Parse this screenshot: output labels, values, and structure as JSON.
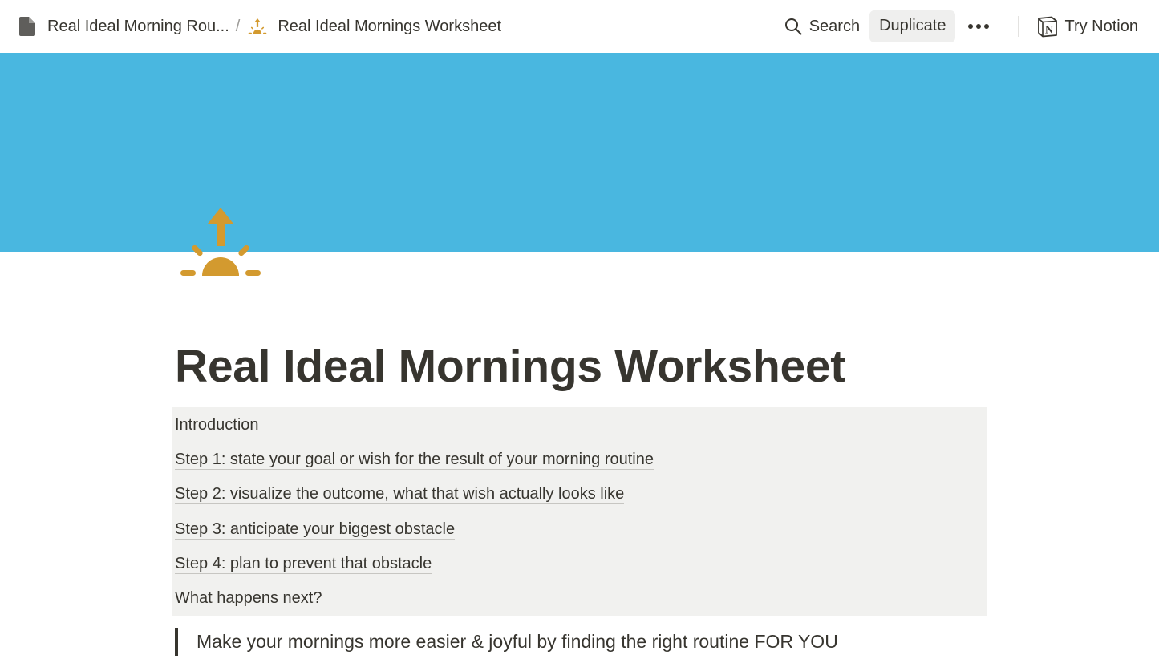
{
  "topbar": {
    "breadcrumb": [
      {
        "label": "Real Ideal Morning Rou...",
        "icon": "document-icon"
      },
      {
        "label": "Real Ideal Mornings Worksheet",
        "icon": "sunrise-icon"
      }
    ],
    "separator": "/",
    "search_label": "Search",
    "duplicate_label": "Duplicate",
    "try_label": "Try Notion"
  },
  "page": {
    "cover_color": "#49b7e0",
    "icon": "sunrise-icon",
    "icon_color": "#d39a2f",
    "title": "Real Ideal Mornings Worksheet",
    "toc": [
      "Introduction",
      "Step 1: state your goal or wish for the result of your morning routine",
      "Step 2: visualize the outcome, what that wish actually looks like",
      "Step 3: anticipate your biggest obstacle",
      "Step 4: plan to prevent that obstacle",
      "What happens next?"
    ],
    "quote": "Make your mornings more easier & joyful by finding the right routine FOR YOU"
  }
}
